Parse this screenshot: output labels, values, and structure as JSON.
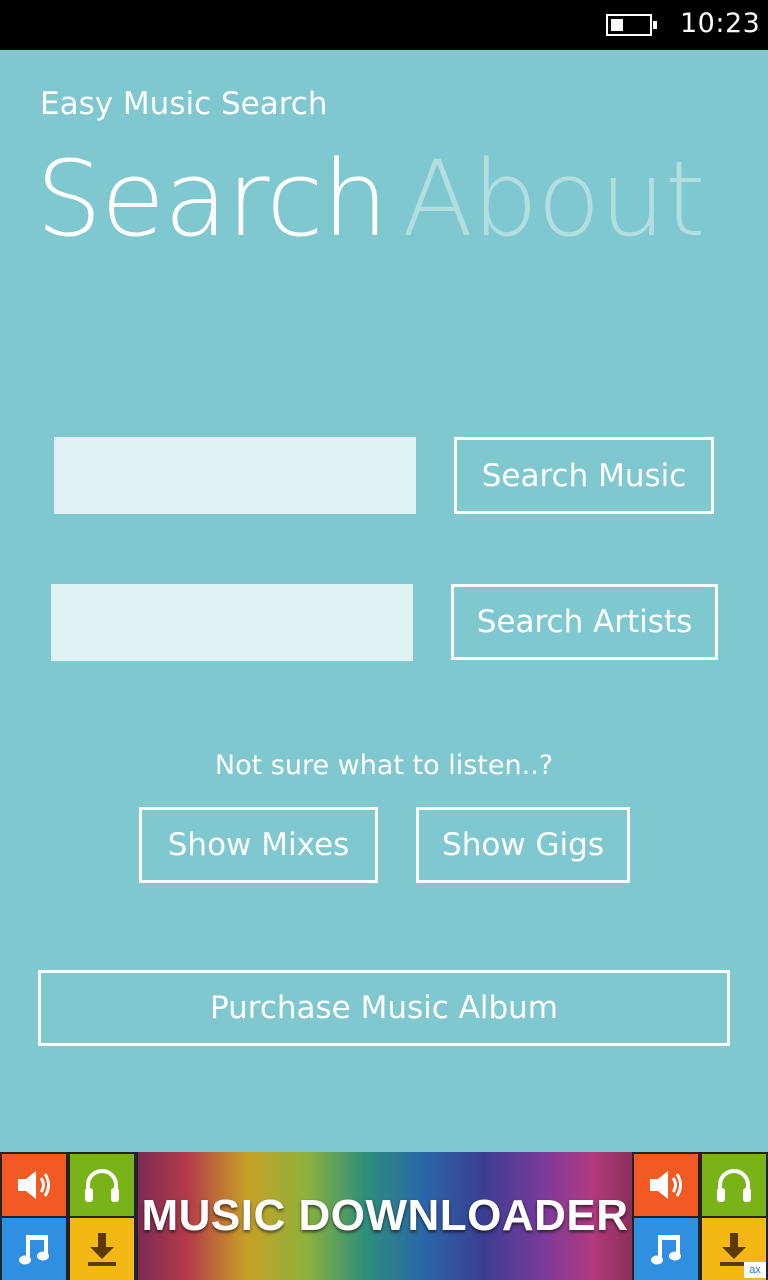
{
  "status_bar": {
    "time": "10:23",
    "battery_icon": "battery-low-icon"
  },
  "app": {
    "title": "Easy Music Search"
  },
  "pivot": {
    "tabs": [
      {
        "label": "Search",
        "selected": true
      },
      {
        "label": "About",
        "selected": false
      }
    ]
  },
  "search": {
    "music_input_value": "",
    "music_button": "Search Music",
    "artist_input_value": "",
    "artist_button": "Search Artists"
  },
  "discover": {
    "hint": "Not sure what to listen..?",
    "mixes_button": "Show Mixes",
    "gigs_button": "Show Gigs"
  },
  "purchase": {
    "button": "Purchase Music Album"
  },
  "ad": {
    "text": "MUSIC DOWNLOADER",
    "badge": "ax",
    "tile_icons": [
      "speaker-icon",
      "headphones-icon",
      "music-note-icon",
      "download-icon"
    ]
  },
  "colors": {
    "background": "#7fc8cf",
    "textbox": "#dff2f3",
    "accent": "#ffffff"
  }
}
